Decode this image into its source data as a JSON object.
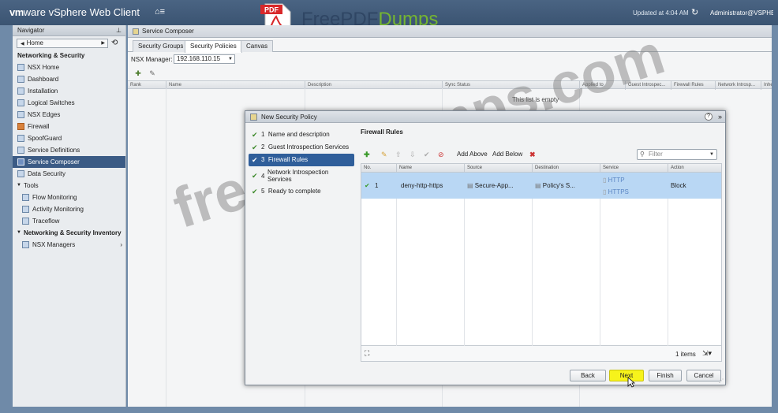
{
  "topbar": {
    "brand_vm": "vm",
    "brand_ware": "ware",
    "brand_product": " vSphere Web Client",
    "updated": "Updated at 4:04 AM",
    "user": "Administrator@VSPHE",
    "pdf_badge": "PDF",
    "pdf_brand_1": "FreePDF",
    "pdf_brand_2": "Dumps"
  },
  "navigator": {
    "title": "Navigator",
    "home": "Home",
    "section": "Networking & Security",
    "items": [
      "NSX Home",
      "Dashboard",
      "Installation",
      "Logical Switches",
      "NSX Edges",
      "Firewall",
      "SpoofGuard",
      "Service Definitions",
      "Service Composer",
      "Data Security"
    ],
    "tools_label": "Tools",
    "tools_items": [
      "Flow Monitoring",
      "Activity Monitoring",
      "Traceflow"
    ],
    "inventory_label": "Networking & Security Inventory",
    "inventory_items": [
      "NSX Managers"
    ]
  },
  "main": {
    "title": "Service Composer",
    "tabs": [
      "Security Groups",
      "Security Policies",
      "Canvas"
    ],
    "nsx_manager_label": "NSX Manager:",
    "nsx_manager_value": "192.168.110.15",
    "grid_columns": [
      "Rank",
      "Name",
      "Description",
      "Sync Status",
      "Applied to",
      "Guest Introspec...",
      "Firewall Rules",
      "Network Introsp...",
      "Inhe"
    ],
    "empty_message": "This list is empty"
  },
  "dialog": {
    "title": "New Security Policy",
    "steps": [
      {
        "num": "1",
        "label": "Name and description"
      },
      {
        "num": "2",
        "label": "Guest Introspection Services"
      },
      {
        "num": "3",
        "label": "Firewall Rules"
      },
      {
        "num": "4",
        "label": "Network Introspection Services"
      },
      {
        "num": "5",
        "label": "Ready to complete"
      }
    ],
    "panel_title": "Firewall Rules",
    "add_above": "Add Above",
    "add_below": "Add Below",
    "filter_placeholder": "Filter",
    "columns": [
      "No.",
      "Name",
      "Source",
      "Destination",
      "Service",
      "Action"
    ],
    "row": {
      "no": "1",
      "name": "deny-http-https",
      "source": "Secure-App...",
      "destination": "Policy's S...",
      "service_1": "HTTP",
      "service_2": "HTTPS",
      "action": "Block"
    },
    "items_count": "1 items",
    "buttons": {
      "back": "Back",
      "next": "Next",
      "finish": "Finish",
      "cancel": "Cancel"
    }
  },
  "watermark": {
    "text_lower": "freepdfdumps",
    "text_upper": ".com"
  },
  "colors": {
    "topbar": "#3b5472",
    "selected_nav": "#3b5b85",
    "active_step": "#2f5e9a",
    "selected_row": "#b9d7f4",
    "next_highlight": "#f7f31b"
  }
}
